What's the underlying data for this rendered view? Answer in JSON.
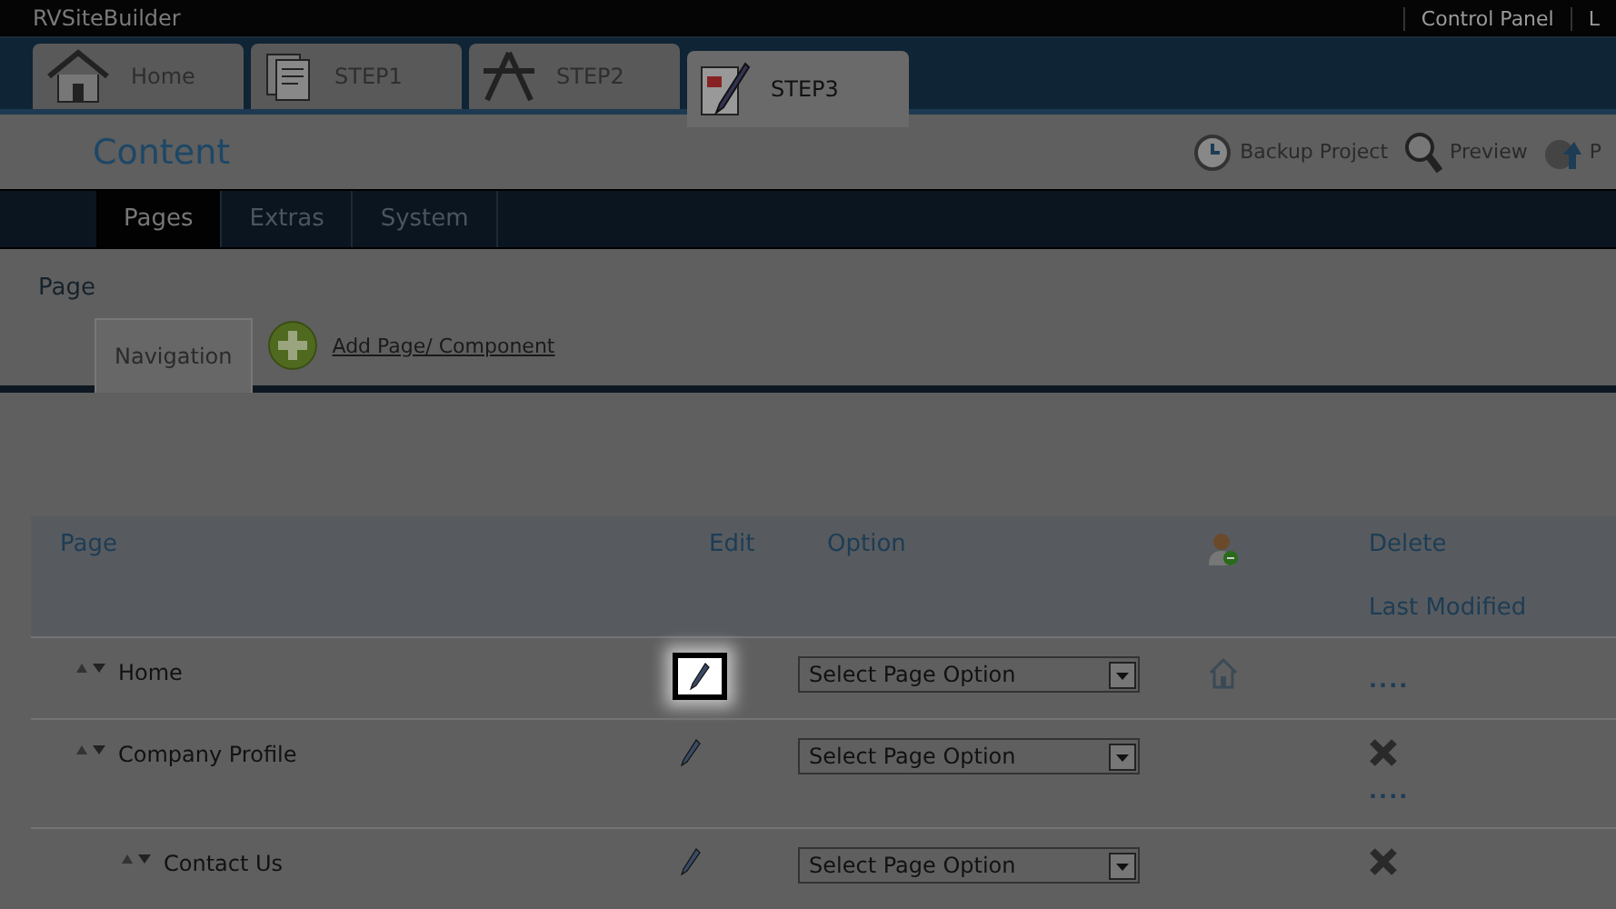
{
  "header": {
    "title": "RVSiteBuilder",
    "links": [
      "Control Panel",
      "L"
    ]
  },
  "steps": [
    {
      "label": "Home",
      "kind": "home",
      "selected": false
    },
    {
      "label": "STEP1",
      "kind": "pages",
      "selected": false
    },
    {
      "label": "STEP2",
      "kind": "tools",
      "selected": false
    },
    {
      "label": "STEP3",
      "kind": "edit",
      "selected": true
    }
  ],
  "section_title": "Content",
  "tools": [
    {
      "label": "Backup Project",
      "kind": "backup"
    },
    {
      "label": "Preview",
      "kind": "preview"
    },
    {
      "label": "P",
      "kind": "publish"
    }
  ],
  "menu": [
    {
      "label": "Pages",
      "selected": true
    },
    {
      "label": "Extras",
      "selected": false
    },
    {
      "label": "System",
      "selected": false
    }
  ],
  "page_label": "Page",
  "panel_tabs": [
    {
      "label": "Navigation",
      "selected": true
    }
  ],
  "add_link": "Add Page/ Component",
  "table": {
    "columns": [
      {
        "kind": "text",
        "label": "Page"
      },
      {
        "kind": "text",
        "label": "Edit"
      },
      {
        "kind": "text",
        "label": "Option"
      },
      {
        "kind": "icon"
      },
      {
        "kind": "stack",
        "label": "Delete",
        "sub": "Last Modified"
      }
    ],
    "rows": [
      {
        "page": "Home",
        "option": "Select Page Option",
        "highlighted": true,
        "home": true,
        "deletable": false,
        "modified": "...."
      },
      {
        "page": "Company Profile",
        "option": "Select Page Option",
        "highlighted": false,
        "home": false,
        "deletable": true,
        "modified": "....",
        "children": [
          {
            "page": "Contact Us",
            "option": "Select Page Option",
            "highlighted": false,
            "home": false,
            "deletable": true
          }
        ]
      }
    ]
  }
}
